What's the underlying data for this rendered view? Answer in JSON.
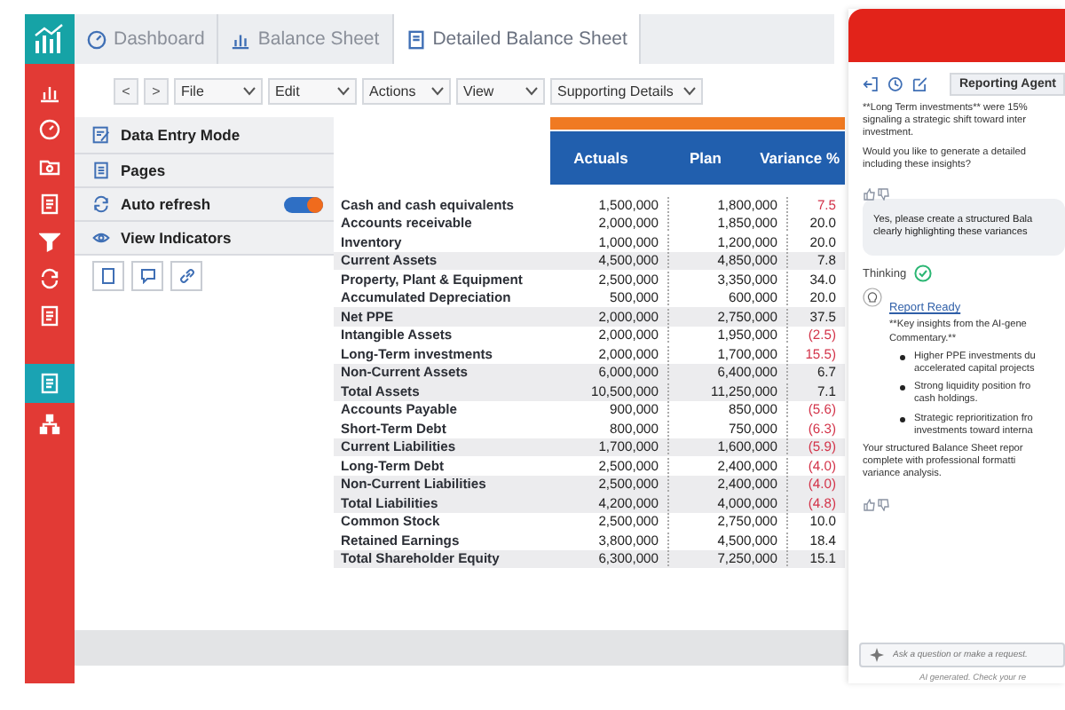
{
  "rail": [
    {
      "selected": false
    },
    {
      "selected": false
    },
    {
      "selected": false
    },
    {
      "selected": false
    },
    {
      "selected": false
    },
    {
      "selected": false
    },
    {
      "selected": false
    },
    {
      "selected": true
    },
    {
      "selected": false
    }
  ],
  "tabs": [
    {
      "label": "Dashboard",
      "selected": false
    },
    {
      "label": "Balance Sheet",
      "selected": false
    },
    {
      "label": "Detailed Balance Sheet",
      "selected": true
    }
  ],
  "toolbar": {
    "nav": [
      "<",
      ">"
    ],
    "menus": [
      "File",
      "Edit",
      "Actions",
      "View",
      "Supporting Details"
    ]
  },
  "panel": [
    {
      "kind": "item",
      "label": "Data Entry Mode"
    },
    {
      "kind": "item",
      "label": "Pages"
    },
    {
      "kind": "toggle",
      "label": "Auto refresh",
      "on": true
    },
    {
      "kind": "item",
      "label": "View Indicators"
    }
  ],
  "table": {
    "columns": [
      "Actuals",
      "Plan",
      "Variance %"
    ],
    "rows": [
      {
        "label": "Cash and cash equivalents",
        "actuals": "1,500,000",
        "plan": "1,800,000",
        "variance": "7.5",
        "subtotal": false,
        "alert": true
      },
      {
        "label": "Accounts receivable",
        "actuals": "2,000,000",
        "plan": "1,850,000",
        "variance": "20.0",
        "subtotal": false,
        "alert": false
      },
      {
        "label": "Inventory",
        "actuals": "1,000,000",
        "plan": "1,200,000",
        "variance": "20.0",
        "subtotal": false,
        "alert": false
      },
      {
        "label": "Current Assets",
        "actuals": "4,500,000",
        "plan": "4,850,000",
        "variance": "7.8",
        "subtotal": true,
        "alert": false
      },
      {
        "label": "Property, Plant & Equipment",
        "actuals": "2,500,000",
        "plan": "3,350,000",
        "variance": "34.0",
        "subtotal": false,
        "alert": false
      },
      {
        "label": "Accumulated Depreciation",
        "actuals": "500,000",
        "plan": "600,000",
        "variance": "20.0",
        "subtotal": false,
        "alert": false
      },
      {
        "label": "Net PPE",
        "actuals": "2,000,000",
        "plan": "2,750,000",
        "variance": "37.5",
        "subtotal": true,
        "alert": false
      },
      {
        "label": "Intangible Assets",
        "actuals": "2,000,000",
        "plan": "1,950,000",
        "variance": "(2.5)",
        "subtotal": false,
        "alert": true
      },
      {
        "label": "Long-Term investments",
        "actuals": "2,000,000",
        "plan": "1,700,000",
        "variance": "15.5)",
        "subtotal": false,
        "alert": true
      },
      {
        "label": "Non-Current Assets",
        "actuals": "6,000,000",
        "plan": "6,400,000",
        "variance": "6.7",
        "subtotal": true,
        "alert": false
      },
      {
        "label": "Total Assets",
        "actuals": "10,500,000",
        "plan": "11,250,000",
        "variance": "7.1",
        "subtotal": true,
        "alert": false
      },
      {
        "label": "Accounts Payable",
        "actuals": "900,000",
        "plan": "850,000",
        "variance": "(5.6)",
        "subtotal": false,
        "alert": true
      },
      {
        "label": "Short-Term Debt",
        "actuals": "800,000",
        "plan": "750,000",
        "variance": "(6.3)",
        "subtotal": false,
        "alert": true
      },
      {
        "label": "Current Liabilities",
        "actuals": "1,700,000",
        "plan": "1,600,000",
        "variance": "(5.9)",
        "subtotal": true,
        "alert": true
      },
      {
        "label": "Long-Term Debt",
        "actuals": "2,500,000",
        "plan": "2,400,000",
        "variance": "(4.0)",
        "subtotal": false,
        "alert": true
      },
      {
        "label": "Non-Current Liabilities",
        "actuals": "2,500,000",
        "plan": "2,400,000",
        "variance": "(4.0)",
        "subtotal": true,
        "alert": true
      },
      {
        "label": "Total Liabilities",
        "actuals": "4,200,000",
        "plan": "4,000,000",
        "variance": "(4.8)",
        "subtotal": true,
        "alert": true
      },
      {
        "label": "Common Stock",
        "actuals": "2,500,000",
        "plan": "2,750,000",
        "variance": "10.0",
        "subtotal": false,
        "alert": false
      },
      {
        "label": "Retained Earnings",
        "actuals": "3,800,000",
        "plan": "4,500,000",
        "variance": "18.4",
        "subtotal": false,
        "alert": false
      },
      {
        "label": "Total Shareholder Equity",
        "actuals": "6,300,000",
        "plan": "7,250,000",
        "variance": "15.1",
        "subtotal": true,
        "alert": false
      }
    ]
  },
  "chat": {
    "agent_button": "Reporting Agent",
    "intro": [
      [
        "**Long Term investments** were 15%",
        "signaling a strategic shift toward inter",
        "investment."
      ],
      [
        "Would you like to generate a detailed",
        "including these insights?"
      ]
    ],
    "user_message": [
      "Yes, please create a structured Bala",
      "clearly highlighting these variances"
    ],
    "status": "Thinking",
    "report_title": "Report Ready",
    "report_intro": [
      "**Key insights from the AI-gene",
      "Commentary.**"
    ],
    "bullets": [
      [
        "Higher PPE investments du",
        "accelerated capital projects"
      ],
      [
        "Strong liquidity position fro",
        "cash holdings."
      ],
      [
        "Strategic reprioritization fro",
        "investments toward interna"
      ]
    ],
    "summary": [
      "Your structured Balance Sheet repor",
      "complete with professional formatti",
      "variance analysis."
    ],
    "input": {
      "placeholder": "Ask a question or make a request."
    },
    "footer": "AI generated. Check your re"
  }
}
